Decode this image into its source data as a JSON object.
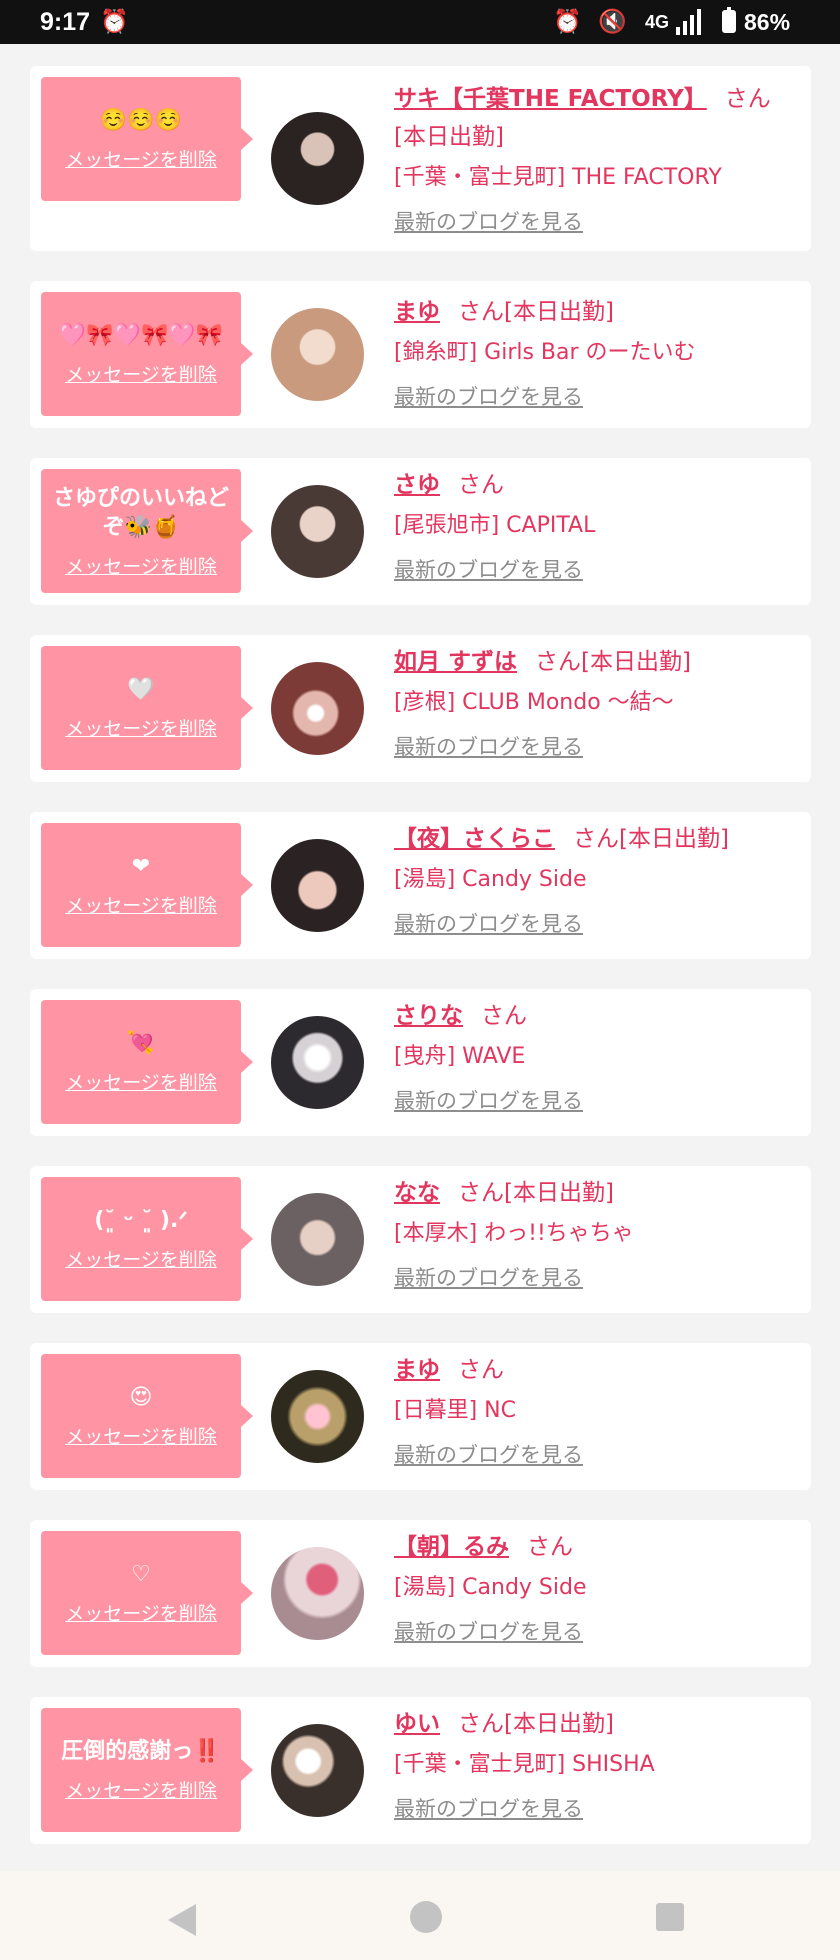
{
  "status_bar": {
    "time": "9:17",
    "network": "4G",
    "battery": "86%"
  },
  "delete_label": "メッセージを削除",
  "blog_label": "最新のブログを見る",
  "entries": [
    {
      "emoji": "☺️☺️☺️",
      "name": "サキ【千葉THE FACTORY】",
      "suffix": "さん[本日出勤]",
      "shop": "[千葉・富士見町] THE FACTORY"
    },
    {
      "emoji": "🩷🎀🩷🎀🩷🎀",
      "name": "まゆ",
      "suffix": "さん[本日出勤]",
      "shop": "[錦糸町] Girls Bar のーたいむ"
    },
    {
      "emoji": "さゆぴのいいねどぞ🐝🍯",
      "name": "さゆ",
      "suffix": "さん",
      "shop": "[尾張旭市] CAPITAL"
    },
    {
      "emoji": "🤍",
      "name": "如月 すずは",
      "suffix": "さん[本日出勤]",
      "shop": "[彦根] CLUB Mondo ～結～"
    },
    {
      "emoji": "❤",
      "name": "【夜】さくらこ",
      "suffix": "さん[本日出勤]",
      "shop": "[湯島] Candy Side"
    },
    {
      "emoji": "💘",
      "name": "さりな",
      "suffix": "さん",
      "shop": "[曳舟] WAVE"
    },
    {
      "emoji": "(˘͈ ᵕ ˘͈ ).ᐟ",
      "name": "なな",
      "suffix": "さん[本日出勤]",
      "shop": "[本厚木] わっ!!ちゃちゃ"
    },
    {
      "emoji": "😍",
      "name": "まゆ",
      "suffix": "さん",
      "shop": "[日暮里] NC"
    },
    {
      "emoji": "♡",
      "name": "【朝】るみ",
      "suffix": "さん",
      "shop": "[湯島] Candy Side"
    },
    {
      "emoji": "圧倒的感謝っ‼️",
      "name": "ゆい",
      "suffix": "さん[本日出勤]",
      "shop": "[千葉・富士見町] SHISHA"
    }
  ]
}
